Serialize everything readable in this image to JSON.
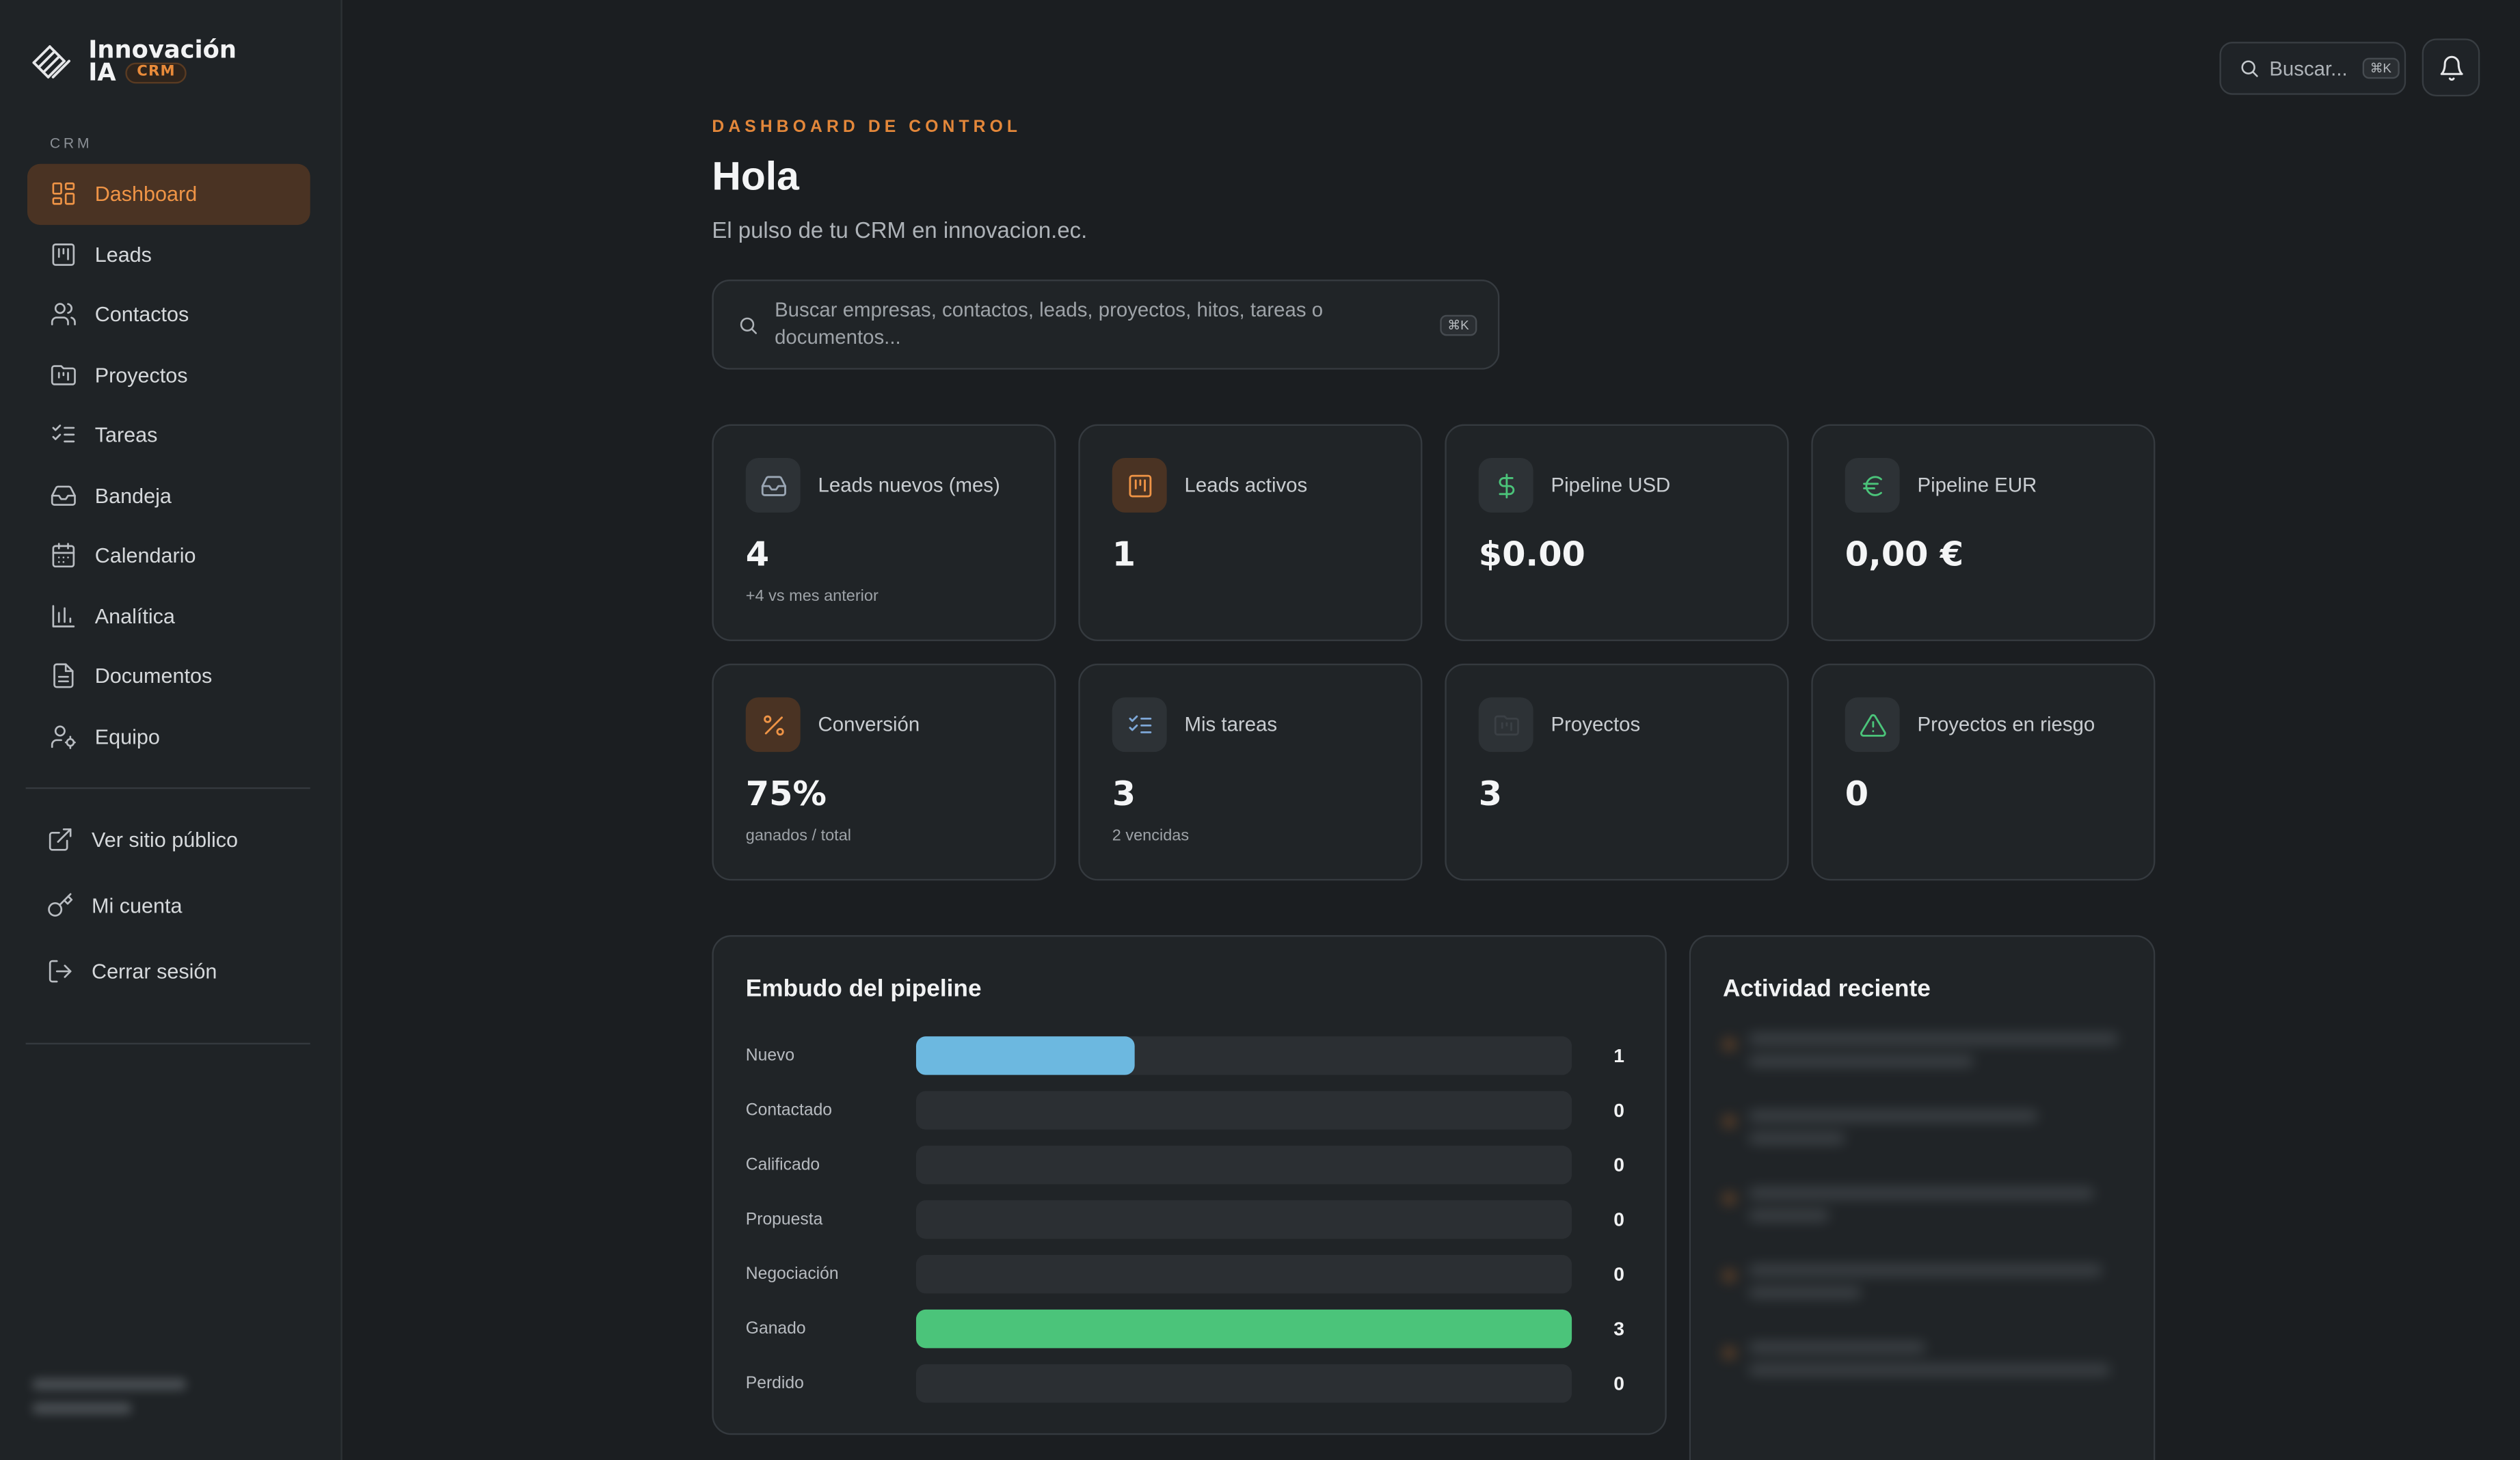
{
  "app": {
    "name_line1": "Innovación",
    "name_line2": "IA",
    "badge": "CRM"
  },
  "sidebar": {
    "section": "CRM",
    "items": [
      {
        "label": "Dashboard",
        "icon": "dashboard-icon",
        "active": true
      },
      {
        "label": "Leads",
        "icon": "kanban-icon"
      },
      {
        "label": "Contactos",
        "icon": "users-icon"
      },
      {
        "label": "Proyectos",
        "icon": "folder-kanban-icon"
      },
      {
        "label": "Tareas",
        "icon": "list-checks-icon"
      },
      {
        "label": "Bandeja",
        "icon": "inbox-icon"
      },
      {
        "label": "Calendario",
        "icon": "calendar-icon"
      },
      {
        "label": "Analítica",
        "icon": "bar-chart-icon"
      },
      {
        "label": "Documentos",
        "icon": "file-text-icon"
      },
      {
        "label": "Equipo",
        "icon": "user-cog-icon"
      }
    ],
    "footer": [
      {
        "label": "Ver sitio público",
        "icon": "external-link-icon"
      },
      {
        "label": "Mi cuenta",
        "icon": "key-icon"
      },
      {
        "label": "Cerrar sesión",
        "icon": "log-out-icon"
      }
    ]
  },
  "topbar": {
    "search_label": "Buscar...",
    "shortcut": "⌘K",
    "bell_icon": "bell-icon"
  },
  "header": {
    "eyebrow": "DASHBOARD DE CONTROL",
    "title": "Hola",
    "subtitle": "El pulso de tu CRM en innovacion.ec."
  },
  "search": {
    "placeholder": "Buscar empresas, contactos, leads, proyectos, hitos, tareas o documentos...",
    "shortcut": "⌘K"
  },
  "cards": [
    {
      "label": "Leads nuevos (mes)",
      "value": "4",
      "hint": "+4 vs mes anterior",
      "icon": "inbox-icon",
      "accent": "#9aa6b4"
    },
    {
      "label": "Leads activos",
      "value": "1",
      "hint": "",
      "icon": "kanban-icon",
      "accent": "#ef9446"
    },
    {
      "label": "Pipeline USD",
      "value": "$0.00",
      "hint": "",
      "icon": "dollar-icon",
      "accent": "#4bc47a"
    },
    {
      "label": "Pipeline EUR",
      "value": "0,00 €",
      "hint": "",
      "icon": "euro-icon",
      "accent": "#4bc47a"
    },
    {
      "label": "Conversión",
      "value": "75%",
      "hint": "ganados / total",
      "icon": "percent-icon",
      "accent": "#ef9446"
    },
    {
      "label": "Mis tareas",
      "value": "3",
      "hint": "2 vencidas",
      "icon": "list-checks-icon",
      "accent": "#7ea8d8"
    },
    {
      "label": "Proyectos",
      "value": "3",
      "hint": "",
      "icon": "folder-kanban-icon",
      "accent": "#3b4045"
    },
    {
      "label": "Proyectos en riesgo",
      "value": "0",
      "hint": "",
      "icon": "alert-triangle-icon",
      "accent": "#4bc47a"
    }
  ],
  "funnel": {
    "title": "Embudo del pipeline",
    "max": 3,
    "colors": {
      "Nuevo": "#6cb8e0",
      "Ganado": "#4bc47a"
    },
    "stages": [
      {
        "name": "Nuevo",
        "value": 1
      },
      {
        "name": "Contactado",
        "value": 0
      },
      {
        "name": "Calificado",
        "value": 0
      },
      {
        "name": "Propuesta",
        "value": 0
      },
      {
        "name": "Negociación",
        "value": 0
      },
      {
        "name": "Ganado",
        "value": 3
      },
      {
        "name": "Perdido",
        "value": 0
      }
    ]
  },
  "activity": {
    "title": "Actividad reciente"
  }
}
